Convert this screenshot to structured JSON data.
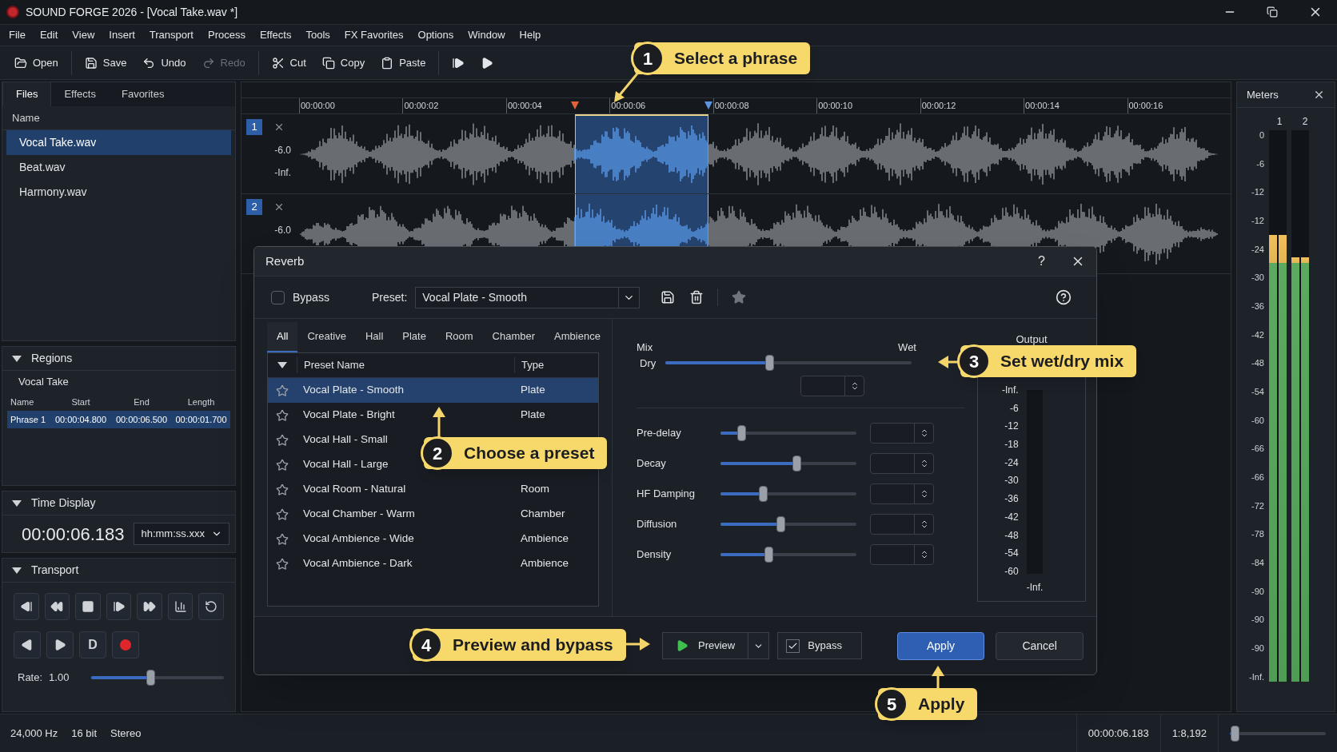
{
  "window": {
    "title": "SOUND FORGE 2026 - [Vocal Take.wav *]"
  },
  "menu": [
    "File",
    "Edit",
    "View",
    "Insert",
    "Transport",
    "Process",
    "Effects",
    "Tools",
    "FX Favorites",
    "Options",
    "Window",
    "Help"
  ],
  "toolbar": [
    [
      {
        "kind": "open",
        "label": "Open",
        "disabled": false
      }
    ],
    [
      {
        "kind": "save",
        "label": "Save",
        "disabled": false
      },
      {
        "kind": "undo",
        "label": "Undo",
        "disabled": false
      },
      {
        "kind": "redo",
        "label": "Redo",
        "disabled": true
      }
    ],
    [
      {
        "kind": "cut",
        "label": "Cut",
        "disabled": false
      },
      {
        "kind": "copy",
        "label": "Copy",
        "disabled": false
      },
      {
        "kind": "paste",
        "label": "Paste",
        "disabled": false
      }
    ],
    [
      {
        "kind": "step",
        "disabled": false
      },
      {
        "kind": "play",
        "disabled": false
      }
    ]
  ],
  "browser": {
    "tabs": [
      {
        "label": "Files",
        "selected": true
      },
      {
        "label": "Effects",
        "selected": false
      },
      {
        "label": "Favorites",
        "selected": false
      }
    ],
    "column": "Name",
    "files": [
      {
        "name": "Vocal Take.wav",
        "selected": true
      },
      {
        "name": "Beat.wav",
        "selected": false
      },
      {
        "name": "Harmony.wav",
        "selected": false
      }
    ]
  },
  "regions": {
    "title": "Regions",
    "expanded": true,
    "file": "Vocal Take",
    "columns": [
      "Name",
      "Start",
      "End",
      "Length"
    ],
    "rows": [
      {
        "cells": [
          "Phrase 1",
          "00:00:04.800",
          "00:00:06.500",
          "00:00:01.700"
        ],
        "selected": true
      }
    ]
  },
  "time_display": {
    "title": "Time Display",
    "expanded": true,
    "time": "00:00:06.183",
    "format": "hh:mm:ss.xxx"
  },
  "transport": {
    "title": "Transport",
    "expanded": true,
    "buttons": [
      {
        "kind": "start"
      },
      {
        "kind": "rewind"
      },
      {
        "kind": "stop"
      },
      {
        "kind": "end"
      },
      {
        "kind": "forward"
      },
      {
        "kind": "bars"
      },
      {
        "kind": "loop"
      }
    ],
    "buttons_2": [
      {
        "kind": "reverse"
      },
      {
        "kind": "play"
      },
      {
        "kind": "text",
        "label": "D"
      },
      {
        "kind": "record"
      }
    ],
    "rate_label": "Rate:",
    "rate": "1.00",
    "rate_slider": {
      "level": 0.45
    }
  },
  "timeline": {
    "ticks": [
      "00:00:00",
      "00:00:02",
      "00:00:04",
      "00:00:06",
      "00:00:08",
      "00:00:10",
      "00:00:12",
      "00:00:14",
      "00:00:16"
    ]
  },
  "tracks": [
    {
      "number": "1",
      "scale": [
        "-6.0",
        "-Inf."
      ]
    },
    {
      "number": "2",
      "scale": [
        "-6.0"
      ]
    }
  ],
  "meters": {
    "title": "Meters",
    "channels": [
      {
        "label": "1",
        "level": 0.81
      },
      {
        "label": "2",
        "level": 0.77
      }
    ],
    "scale": [
      "0",
      "-6",
      "-12",
      "-12",
      "-24",
      "-30",
      "-36",
      "-42",
      "-48",
      "-54",
      "-60",
      "-66",
      "-66",
      "-72",
      "-78",
      "-84",
      "-90",
      "-90",
      "-90",
      "-Inf."
    ]
  },
  "dialog": {
    "title": "Reverb",
    "help": "?",
    "bypass": {
      "label": "Bypass",
      "checked": false
    },
    "preset_label": "Preset:",
    "preset": "Vocal Plate - Smooth",
    "tabs": [
      {
        "label": "All",
        "selected": true
      },
      {
        "label": "Creative",
        "selected": false
      },
      {
        "label": "Hall",
        "selected": false
      },
      {
        "label": "Plate",
        "selected": false
      },
      {
        "label": "Room",
        "selected": false
      },
      {
        "label": "Chamber",
        "selected": false
      },
      {
        "label": "Ambience",
        "selected": false
      }
    ],
    "columns": [
      "Preset Name",
      "Type"
    ],
    "presets": [
      {
        "name": "Vocal Plate - Smooth",
        "type": "Plate",
        "selected": true,
        "favorite": false
      },
      {
        "name": "Vocal Plate - Bright",
        "type": "Plate",
        "selected": false,
        "favorite": false
      },
      {
        "name": "Vocal Hall - Small",
        "selected": false,
        "favorite": false
      },
      {
        "name": "Vocal Hall - Large",
        "selected": false,
        "favorite": false
      },
      {
        "name": "Vocal Room - Natural",
        "type": "Room",
        "selected": false,
        "favorite": false
      },
      {
        "name": "Vocal Chamber - Warm",
        "type": "Chamber",
        "selected": false,
        "favorite": false
      },
      {
        "name": "Vocal Ambience - Wide",
        "type": "Ambience",
        "selected": false,
        "favorite": false
      },
      {
        "name": "Vocal Ambience - Dark",
        "type": "Ambience",
        "selected": false,
        "favorite": false
      }
    ],
    "mix": {
      "title": "Mix",
      "dry": "Dry",
      "wet": "Wet",
      "level": 0.42
    },
    "params": [
      {
        "label": "Pre-delay",
        "level": 0.15
      },
      {
        "label": "Decay",
        "level": 0.56
      },
      {
        "label": "HF Damping",
        "level": 0.31
      },
      {
        "label": "Diffusion",
        "level": 0.44
      },
      {
        "label": "Density",
        "level": 0.35
      }
    ],
    "output": {
      "title": "Output",
      "scale": [
        "-Inf.",
        "-6",
        "-12",
        "-18",
        "-24",
        "-30",
        "-36",
        "-42",
        "-48",
        "-54",
        "-60"
      ],
      "bottom": "-Inf."
    },
    "preview": "Preview",
    "bypass_2": {
      "label": "Bypass",
      "checked": true
    },
    "apply": "Apply",
    "cancel": "Cancel"
  },
  "status_bar": {
    "items": [
      "24,000 Hz",
      "16 bit",
      "Stereo"
    ],
    "time": "00:00:06.183",
    "zoom": "1:8,192",
    "zoom_slider": {
      "level": 0.05
    }
  },
  "callouts": [
    {
      "number": "1",
      "text": "Select a phrase"
    },
    {
      "number": "2",
      "text": "Choose a preset"
    },
    {
      "number": "3",
      "text": "Set wet/dry mix"
    },
    {
      "number": "4",
      "text": "Preview and bypass"
    },
    {
      "number": "5",
      "text": "Apply"
    }
  ]
}
